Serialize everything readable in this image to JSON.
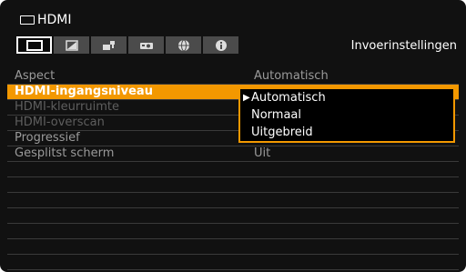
{
  "header": {
    "title": "HDMI",
    "menu_title": "Invoerinstellingen",
    "tabs": [
      {
        "icon": "screen-icon",
        "active": true
      },
      {
        "icon": "image-adjust-icon",
        "active": false
      },
      {
        "icon": "installation-icon",
        "active": false
      },
      {
        "icon": "projector-settings-icon",
        "active": false
      },
      {
        "icon": "network-globe-icon",
        "active": false
      },
      {
        "icon": "info-icon",
        "active": false
      }
    ]
  },
  "menu": {
    "items": [
      {
        "label": "Aspect",
        "value": "Automatisch"
      },
      {
        "label": "HDMI-ingangsniveau",
        "value": ""
      },
      {
        "label": "HDMI-kleurruimte",
        "value": ""
      },
      {
        "label": "HDMI-overscan",
        "value": ""
      },
      {
        "label": "Progressief",
        "value": ""
      },
      {
        "label": "Gesplitst scherm",
        "value": "Uit"
      }
    ]
  },
  "dropdown": {
    "options": [
      "Automatisch",
      "Normaal",
      "Uitgebreid"
    ],
    "selected": "Automatisch"
  },
  "colors": {
    "highlight": "#f39800",
    "background": "#111111",
    "dim_text": "#5e5e5e"
  }
}
